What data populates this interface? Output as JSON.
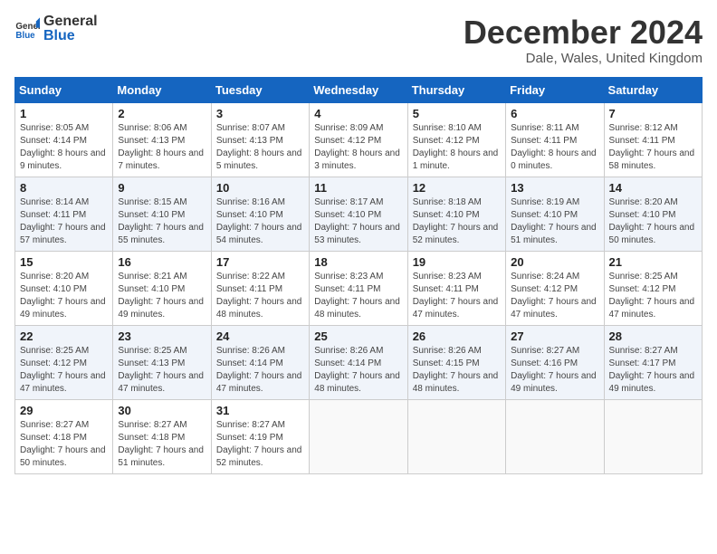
{
  "logo": {
    "general": "General",
    "blue": "Blue"
  },
  "header": {
    "title": "December 2024",
    "subtitle": "Dale, Wales, United Kingdom"
  },
  "weekdays": [
    "Sunday",
    "Monday",
    "Tuesday",
    "Wednesday",
    "Thursday",
    "Friday",
    "Saturday"
  ],
  "weeks": [
    [
      {
        "day": "1",
        "sunrise": "Sunrise: 8:05 AM",
        "sunset": "Sunset: 4:14 PM",
        "daylight": "Daylight: 8 hours and 9 minutes."
      },
      {
        "day": "2",
        "sunrise": "Sunrise: 8:06 AM",
        "sunset": "Sunset: 4:13 PM",
        "daylight": "Daylight: 8 hours and 7 minutes."
      },
      {
        "day": "3",
        "sunrise": "Sunrise: 8:07 AM",
        "sunset": "Sunset: 4:13 PM",
        "daylight": "Daylight: 8 hours and 5 minutes."
      },
      {
        "day": "4",
        "sunrise": "Sunrise: 8:09 AM",
        "sunset": "Sunset: 4:12 PM",
        "daylight": "Daylight: 8 hours and 3 minutes."
      },
      {
        "day": "5",
        "sunrise": "Sunrise: 8:10 AM",
        "sunset": "Sunset: 4:12 PM",
        "daylight": "Daylight: 8 hours and 1 minute."
      },
      {
        "day": "6",
        "sunrise": "Sunrise: 8:11 AM",
        "sunset": "Sunset: 4:11 PM",
        "daylight": "Daylight: 8 hours and 0 minutes."
      },
      {
        "day": "7",
        "sunrise": "Sunrise: 8:12 AM",
        "sunset": "Sunset: 4:11 PM",
        "daylight": "Daylight: 7 hours and 58 minutes."
      }
    ],
    [
      {
        "day": "8",
        "sunrise": "Sunrise: 8:14 AM",
        "sunset": "Sunset: 4:11 PM",
        "daylight": "Daylight: 7 hours and 57 minutes."
      },
      {
        "day": "9",
        "sunrise": "Sunrise: 8:15 AM",
        "sunset": "Sunset: 4:10 PM",
        "daylight": "Daylight: 7 hours and 55 minutes."
      },
      {
        "day": "10",
        "sunrise": "Sunrise: 8:16 AM",
        "sunset": "Sunset: 4:10 PM",
        "daylight": "Daylight: 7 hours and 54 minutes."
      },
      {
        "day": "11",
        "sunrise": "Sunrise: 8:17 AM",
        "sunset": "Sunset: 4:10 PM",
        "daylight": "Daylight: 7 hours and 53 minutes."
      },
      {
        "day": "12",
        "sunrise": "Sunrise: 8:18 AM",
        "sunset": "Sunset: 4:10 PM",
        "daylight": "Daylight: 7 hours and 52 minutes."
      },
      {
        "day": "13",
        "sunrise": "Sunrise: 8:19 AM",
        "sunset": "Sunset: 4:10 PM",
        "daylight": "Daylight: 7 hours and 51 minutes."
      },
      {
        "day": "14",
        "sunrise": "Sunrise: 8:20 AM",
        "sunset": "Sunset: 4:10 PM",
        "daylight": "Daylight: 7 hours and 50 minutes."
      }
    ],
    [
      {
        "day": "15",
        "sunrise": "Sunrise: 8:20 AM",
        "sunset": "Sunset: 4:10 PM",
        "daylight": "Daylight: 7 hours and 49 minutes."
      },
      {
        "day": "16",
        "sunrise": "Sunrise: 8:21 AM",
        "sunset": "Sunset: 4:10 PM",
        "daylight": "Daylight: 7 hours and 49 minutes."
      },
      {
        "day": "17",
        "sunrise": "Sunrise: 8:22 AM",
        "sunset": "Sunset: 4:11 PM",
        "daylight": "Daylight: 7 hours and 48 minutes."
      },
      {
        "day": "18",
        "sunrise": "Sunrise: 8:23 AM",
        "sunset": "Sunset: 4:11 PM",
        "daylight": "Daylight: 7 hours and 48 minutes."
      },
      {
        "day": "19",
        "sunrise": "Sunrise: 8:23 AM",
        "sunset": "Sunset: 4:11 PM",
        "daylight": "Daylight: 7 hours and 47 minutes."
      },
      {
        "day": "20",
        "sunrise": "Sunrise: 8:24 AM",
        "sunset": "Sunset: 4:12 PM",
        "daylight": "Daylight: 7 hours and 47 minutes."
      },
      {
        "day": "21",
        "sunrise": "Sunrise: 8:25 AM",
        "sunset": "Sunset: 4:12 PM",
        "daylight": "Daylight: 7 hours and 47 minutes."
      }
    ],
    [
      {
        "day": "22",
        "sunrise": "Sunrise: 8:25 AM",
        "sunset": "Sunset: 4:12 PM",
        "daylight": "Daylight: 7 hours and 47 minutes."
      },
      {
        "day": "23",
        "sunrise": "Sunrise: 8:25 AM",
        "sunset": "Sunset: 4:13 PM",
        "daylight": "Daylight: 7 hours and 47 minutes."
      },
      {
        "day": "24",
        "sunrise": "Sunrise: 8:26 AM",
        "sunset": "Sunset: 4:14 PM",
        "daylight": "Daylight: 7 hours and 47 minutes."
      },
      {
        "day": "25",
        "sunrise": "Sunrise: 8:26 AM",
        "sunset": "Sunset: 4:14 PM",
        "daylight": "Daylight: 7 hours and 48 minutes."
      },
      {
        "day": "26",
        "sunrise": "Sunrise: 8:26 AM",
        "sunset": "Sunset: 4:15 PM",
        "daylight": "Daylight: 7 hours and 48 minutes."
      },
      {
        "day": "27",
        "sunrise": "Sunrise: 8:27 AM",
        "sunset": "Sunset: 4:16 PM",
        "daylight": "Daylight: 7 hours and 49 minutes."
      },
      {
        "day": "28",
        "sunrise": "Sunrise: 8:27 AM",
        "sunset": "Sunset: 4:17 PM",
        "daylight": "Daylight: 7 hours and 49 minutes."
      }
    ],
    [
      {
        "day": "29",
        "sunrise": "Sunrise: 8:27 AM",
        "sunset": "Sunset: 4:18 PM",
        "daylight": "Daylight: 7 hours and 50 minutes."
      },
      {
        "day": "30",
        "sunrise": "Sunrise: 8:27 AM",
        "sunset": "Sunset: 4:18 PM",
        "daylight": "Daylight: 7 hours and 51 minutes."
      },
      {
        "day": "31",
        "sunrise": "Sunrise: 8:27 AM",
        "sunset": "Sunset: 4:19 PM",
        "daylight": "Daylight: 7 hours and 52 minutes."
      },
      null,
      null,
      null,
      null
    ]
  ]
}
